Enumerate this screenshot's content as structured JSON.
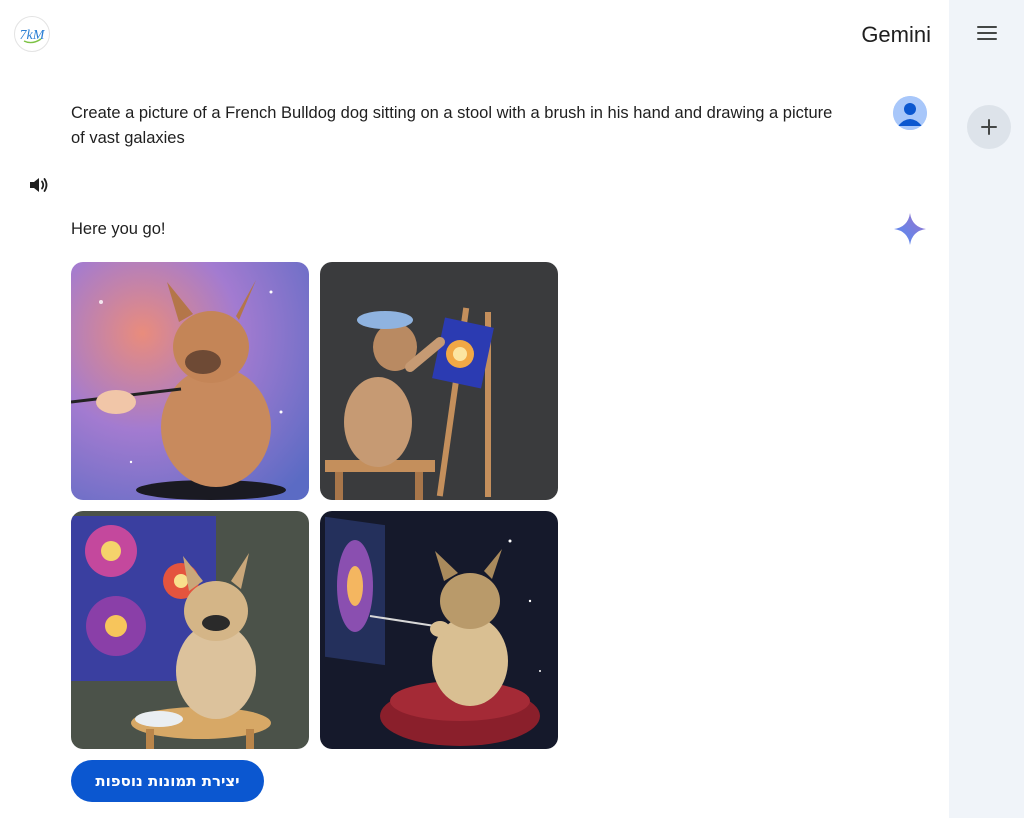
{
  "header": {
    "logo_text": "7kM",
    "app_title": "Gemini"
  },
  "sidebar": {
    "menu_icon": "hamburger-menu-icon",
    "new_chat_icon": "plus-icon"
  },
  "conversation": {
    "prompt": "Create a picture of a French Bulldog dog sitting on a stool with a brush in his hand and drawing a picture of vast galaxies",
    "response_text": "Here you go!",
    "images": [
      {
        "subject": "french-bulldog-nebula-background-held-brush"
      },
      {
        "subject": "french-bulldog-beret-painting-at-easel"
      },
      {
        "subject": "french-bulldog-stool-galaxy-canvas"
      },
      {
        "subject": "french-bulldog-cushion-painting-galaxy"
      }
    ],
    "generate_more_label": "יצירת תמונות נוספות"
  },
  "colors": {
    "primary_button": "#0b57d0",
    "rail_background": "#f0f4f9",
    "text": "#1f1f1f"
  }
}
